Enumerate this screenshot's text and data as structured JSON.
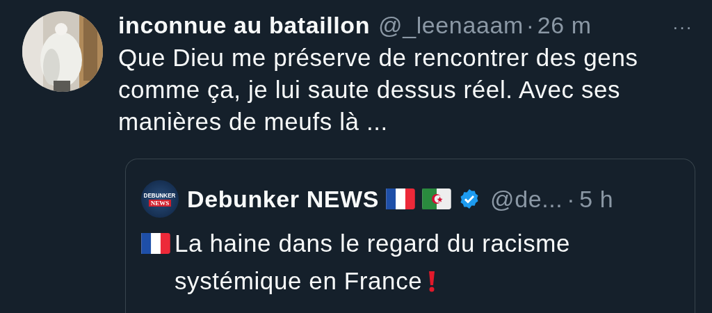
{
  "tweet": {
    "display_name": "inconnue au bataillon",
    "handle": "@_leenaaam",
    "separator": "·",
    "time": "26 m",
    "more": "···",
    "text": "Que Dieu me préserve de rencontrer des gens comme ça, je lui saute dessus réel. Avec ses manières de meufs là ..."
  },
  "quoted_tweet": {
    "avatar_logo": [
      "DEBUNKER",
      "NEWS"
    ],
    "display_name": "Debunker NEWS",
    "verified": true,
    "handle": "@de...",
    "separator": "·",
    "time": "5 h",
    "text": "La haine dans le regard du racisme systémique en France"
  }
}
